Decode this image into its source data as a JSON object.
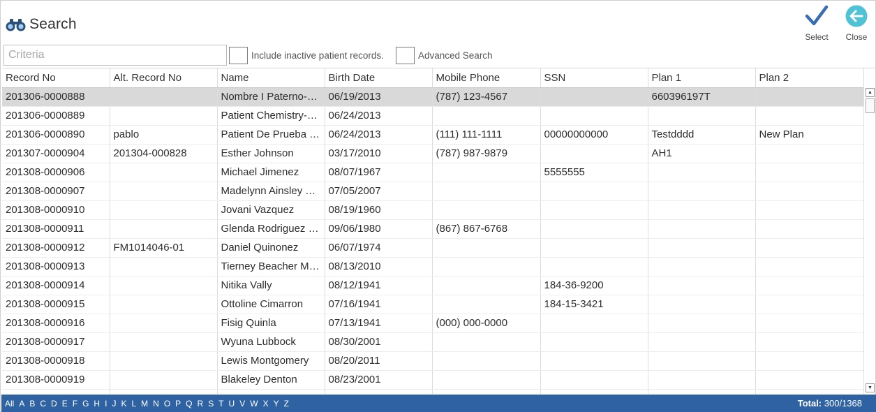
{
  "header": {
    "title": "Search"
  },
  "actions": {
    "select_label": "Select",
    "close_label": "Close"
  },
  "search": {
    "placeholder": "Criteria",
    "value": ""
  },
  "options": {
    "inactive_label": "Include inactive patient records.",
    "advanced_label": "Advanced Search"
  },
  "grid": {
    "columns": [
      "Record No",
      "Alt. Record No",
      "Name",
      "Birth Date",
      "Mobile Phone",
      "SSN",
      "Plan 1",
      "Plan 2"
    ],
    "rows": [
      [
        "201306-0000888",
        "",
        "Nombre I Paterno-Materno",
        "06/19/2013",
        "(787) 123-4567",
        "",
        "660396197T",
        ""
      ],
      [
        "201306-0000889",
        "",
        "Patient Chemistry-Test",
        "06/24/2013",
        "",
        "",
        "",
        ""
      ],
      [
        "201306-0000890",
        "pablo",
        "Patient De Prueba Test",
        "06/24/2013",
        "(111) 111-1111",
        "00000000000",
        "Testdddd",
        "New Plan"
      ],
      [
        "201307-0000904",
        "201304-000828",
        "Esther Johnson",
        "03/17/2010",
        "(787) 987-9879",
        "",
        "AH1",
        ""
      ],
      [
        "201308-0000906",
        "",
        "Michael Jimenez",
        "08/07/1967",
        "",
        "5555555",
        "",
        ""
      ],
      [
        "201308-0000907",
        "",
        "Madelynn Ainsley Thomas",
        "07/05/2007",
        "",
        "",
        "",
        ""
      ],
      [
        "201308-0000910",
        "",
        "Jovani Vazquez",
        "08/19/1960",
        "",
        "",
        "",
        ""
      ],
      [
        "201308-0000911",
        "",
        "Glenda Rodriguez Rivera",
        "09/06/1980",
        "(867) 867-6768",
        "",
        "",
        ""
      ],
      [
        "201308-0000912",
        "FM1014046-01",
        "Daniel Quinonez",
        "06/07/1974",
        "",
        "",
        "",
        ""
      ],
      [
        "201308-0000913",
        "",
        "Tierney Beacher Martinez",
        "08/13/2010",
        "",
        "",
        "",
        ""
      ],
      [
        "201308-0000914",
        "",
        "Nitika Vally",
        "08/12/1941",
        "",
        "184-36-9200",
        "",
        ""
      ],
      [
        "201308-0000915",
        "",
        "Ottoline Cimarron",
        "07/16/1941",
        "",
        "184-15-3421",
        "",
        ""
      ],
      [
        "201308-0000916",
        "",
        "Fisig Quinla",
        "07/13/1941",
        "(000) 000-0000",
        "",
        "",
        ""
      ],
      [
        "201308-0000917",
        "",
        "Wyuna Lubbock",
        "08/30/2001",
        "",
        "",
        "",
        ""
      ],
      [
        "201308-0000918",
        "",
        "Lewis Montgomery",
        "08/20/2011",
        "",
        "",
        "",
        ""
      ],
      [
        "201308-0000919",
        "",
        "Blakeley Denton",
        "08/23/2001",
        "",
        "",
        "",
        ""
      ],
      [
        "",
        "",
        "",
        "",
        "",
        "",
        "",
        ""
      ]
    ],
    "selected_row": 0
  },
  "footer": {
    "letters": [
      "All",
      "A",
      "B",
      "C",
      "D",
      "E",
      "F",
      "G",
      "H",
      "I",
      "J",
      "K",
      "L",
      "M",
      "N",
      "O",
      "P",
      "Q",
      "R",
      "S",
      "T",
      "U",
      "V",
      "W",
      "X",
      "Y",
      "Z"
    ],
    "total_label": "Total:",
    "total_value": "300/1368"
  },
  "colors": {
    "accent": "#2f62a3",
    "check": "#3a6db4",
    "close": "#4fc2d6",
    "selected_row": "#d9d9d9"
  },
  "icons": {
    "title": "binoculars-icon",
    "select": "checkmark-icon",
    "close": "back-arrow-icon"
  }
}
